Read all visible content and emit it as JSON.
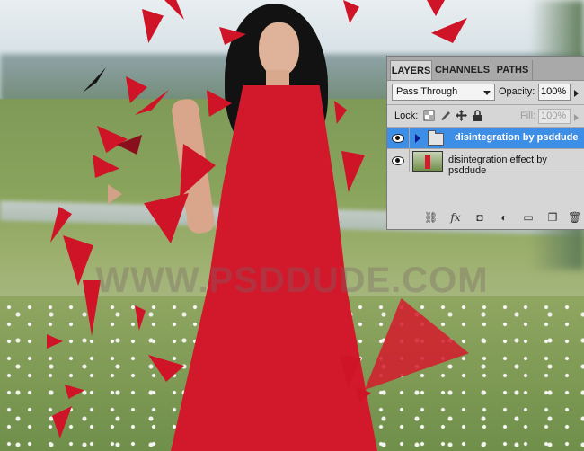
{
  "watermark": "WWW.PSDDUDE.COM",
  "panel": {
    "tabs": [
      {
        "label": "LAYERS",
        "active": true
      },
      {
        "label": "CHANNELS",
        "active": false
      },
      {
        "label": "PATHS",
        "active": false
      }
    ],
    "blend_mode": "Pass Through",
    "opacity_label": "Opacity:",
    "opacity_value": "100%",
    "lock_label": "Lock:",
    "fill_label": "Fill:",
    "fill_value": "100%",
    "layers": [
      {
        "name": "disintegration by psddude",
        "type": "group",
        "visible": true,
        "selected": true
      },
      {
        "name": "disintegration effect by psddude",
        "type": "pixel",
        "visible": true,
        "selected": false
      }
    ],
    "footer_icons": [
      "link-layers-icon",
      "fx-icon",
      "mask-icon",
      "adjustment-icon",
      "new-group-icon",
      "new-layer-icon",
      "trash-icon"
    ],
    "colors": {
      "selection": "#3d8ee6",
      "panel_bg": "#d6d6d6",
      "tab_bar": "#a9a9a9"
    }
  },
  "footer_glyphs": {
    "link": "⛓",
    "fx": "fx",
    "mask": "◘",
    "adjust": "◐",
    "group": "▭",
    "new": "❐",
    "trash": "🗑"
  }
}
